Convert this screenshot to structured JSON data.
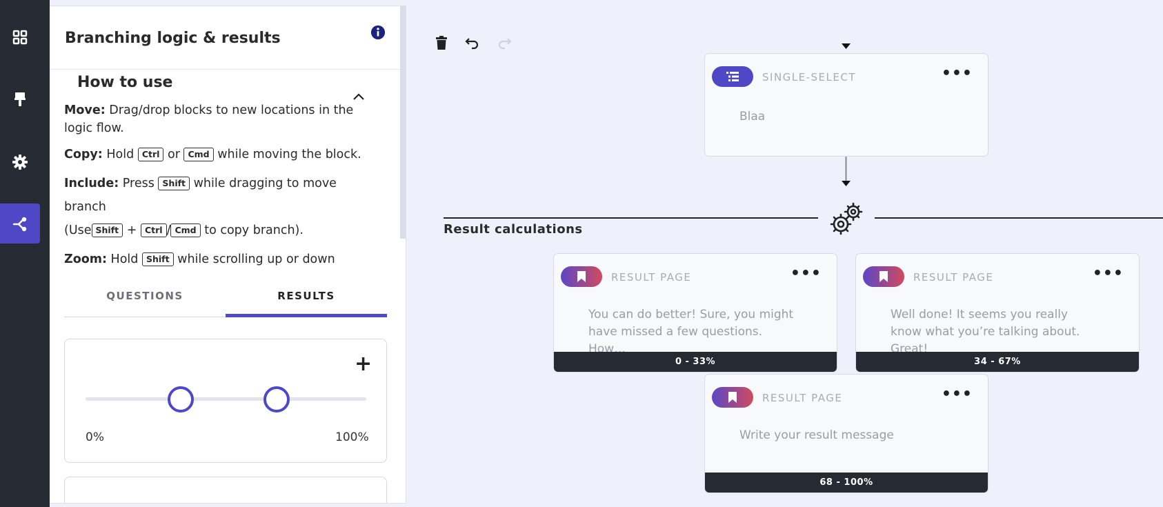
{
  "sidebar": {
    "items": [
      {
        "name": "blocks",
        "icon": "grid-icon"
      },
      {
        "name": "design",
        "icon": "paint-brush-icon"
      },
      {
        "name": "settings",
        "icon": "gear-icon"
      },
      {
        "name": "branching",
        "icon": "branch-icon",
        "active": true
      }
    ]
  },
  "panel": {
    "title": "Branching logic & results",
    "howto": {
      "title": "How to use",
      "move_label": "Move:",
      "move_text": "Drag/drop blocks to new locations in the logic flow.",
      "copy_label": "Copy:",
      "copy_pre": "Hold",
      "copy_or": "or",
      "copy_post": "while moving the block.",
      "include_label": "Include:",
      "include_pre": "Press",
      "include_post": "while dragging to move branch",
      "include_use": "(Use",
      "include_plus": "+",
      "include_slash": "/",
      "include_end": "to copy branch).",
      "zoom_label": "Zoom:",
      "zoom_pre": "Hold",
      "zoom_post": "while scrolling up or down",
      "keys": {
        "ctrl": "Ctrl",
        "cmd": "Cmd",
        "shift": "Shift"
      }
    },
    "tabs": [
      {
        "label": "QUESTIONS",
        "active": false
      },
      {
        "label": "RESULTS",
        "active": true
      }
    ],
    "range": {
      "min_label": "0%",
      "max_label": "100%",
      "handles": [
        0.34,
        0.68
      ]
    }
  },
  "canvas": {
    "section_title": "Result calculations",
    "question_node": {
      "type": "SINGLE-SELECT",
      "text": "Blaa"
    },
    "result_nodes": [
      {
        "type": "RESULT PAGE",
        "text": "You can do better! Sure, you might have missed a few questions. How…",
        "range": "0 - 33%"
      },
      {
        "type": "RESULT PAGE",
        "text": "Well done! It seems you really know what you’re talking about. Great!",
        "range": "34 - 67%"
      },
      {
        "type": "RESULT PAGE",
        "text": "Write your result message",
        "range": "68 - 100%"
      }
    ]
  },
  "colors": {
    "accent": "#4e47c6",
    "rail": "#262a33",
    "canvas": "#eef1fb"
  }
}
